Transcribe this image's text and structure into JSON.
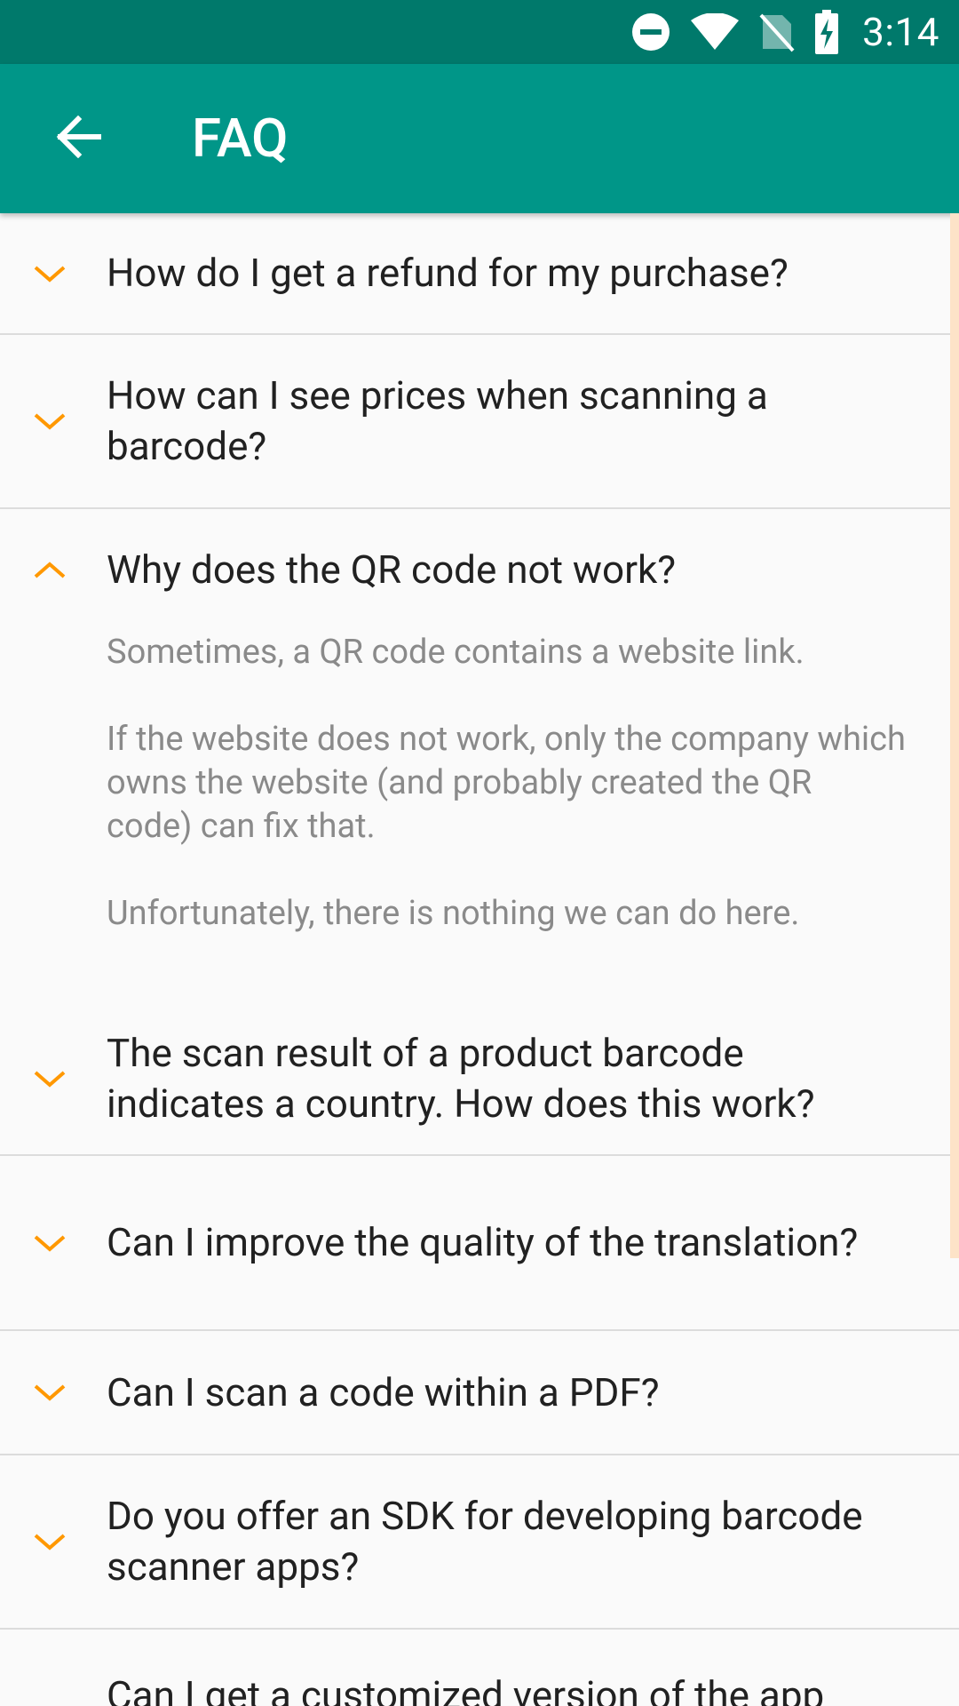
{
  "status_bar": {
    "time": "3:14",
    "icons": [
      "do-not-disturb-icon",
      "wifi-icon",
      "no-sim-icon",
      "battery-charging-icon"
    ]
  },
  "app_bar": {
    "title": "FAQ",
    "back_icon": "arrow-back-icon"
  },
  "colors": {
    "status_bar": "#00796b",
    "app_bar": "#009688",
    "chevron": "#ff9800",
    "question_text": "#212121",
    "answer_text": "#8a8a8a",
    "divider": "#dcdcdc",
    "background": "#fafafa"
  },
  "faq": {
    "items": [
      {
        "question": "How do I get a refund for my purchase?",
        "expanded": false
      },
      {
        "question": "How can I see prices when scanning a barcode?",
        "expanded": false
      },
      {
        "question": "Why does the QR code not work?",
        "expanded": true,
        "answer": [
          "Sometimes, a QR code contains a website link.",
          "If the website does not work, only the company which owns the website (and probably created the QR code) can fix that.",
          "Unfortunately, there is nothing we can do here."
        ]
      },
      {
        "question": "The scan result of a product barcode indicates a country. How does this work?",
        "expanded": false
      },
      {
        "question": "Can I improve the quality of the translation?",
        "expanded": false
      },
      {
        "question": "Can I scan a code within a PDF?",
        "expanded": false
      },
      {
        "question": "Do you offer an SDK for developing barcode scanner apps?",
        "expanded": false
      },
      {
        "question": "Can I get a customized version of the app",
        "expanded": false
      }
    ]
  }
}
